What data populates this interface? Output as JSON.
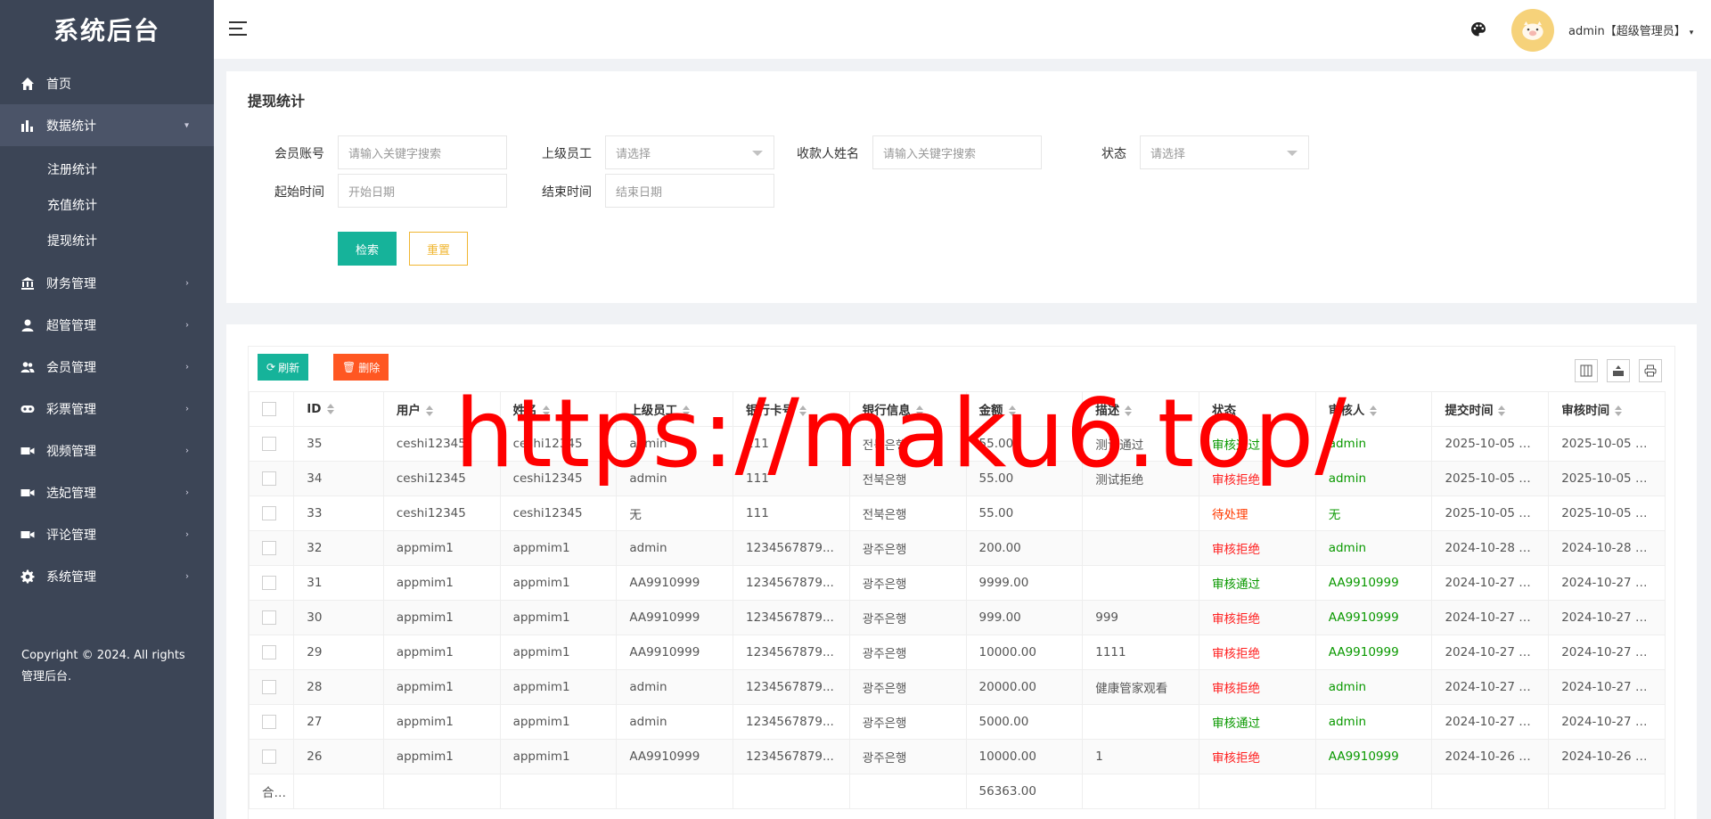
{
  "brand": "系统后台",
  "sidebar": {
    "items": [
      {
        "label": "首页",
        "icon": "home-icon"
      },
      {
        "label": "数据统计",
        "icon": "bar-chart-icon",
        "sub": [
          "注册统计",
          "充值统计",
          "提现统计"
        ]
      },
      {
        "label": "财务管理",
        "icon": "bank-icon"
      },
      {
        "label": "超管管理",
        "icon": "user-icon"
      },
      {
        "label": "会员管理",
        "icon": "users-icon"
      },
      {
        "label": "彩票管理",
        "icon": "gamepad-icon"
      },
      {
        "label": "视频管理",
        "icon": "video-icon"
      },
      {
        "label": "选妃管理",
        "icon": "video-icon"
      },
      {
        "label": "评论管理",
        "icon": "video-icon"
      },
      {
        "label": "系统管理",
        "icon": "gear-icon"
      }
    ],
    "copyright": "Copyright © 2024. All rights 管理后台."
  },
  "header": {
    "user": "admin【超级管理员】"
  },
  "filter": {
    "title": "提现统计",
    "member_label": "会员账号",
    "member_placeholder": "请输入关键字搜索",
    "superior_label": "上级员工",
    "superior_placeholder": "请选择",
    "payee_label": "收款人姓名",
    "payee_placeholder": "请输入关键字搜索",
    "status_label": "状态",
    "status_placeholder": "请选择",
    "start_label": "起始时间",
    "start_placeholder": "开始日期",
    "end_label": "结束时间",
    "end_placeholder": "结束日期",
    "search_button": "检索",
    "reset_button": "重置"
  },
  "toolbar": {
    "refresh": "刷新",
    "delete": "删除"
  },
  "table": {
    "columns": [
      "ID",
      "用户",
      "姓名",
      "上级员工",
      "银行卡号",
      "银行信息",
      "金额",
      "描述",
      "状态",
      "审核人",
      "提交时间",
      "审核时间"
    ],
    "rows": [
      [
        "35",
        "ceshi12345",
        "ceshi12345",
        "admin",
        "111",
        "전북은행",
        "55.00",
        "测试通过",
        "审核通过",
        "admin",
        "2025-10-05 1...",
        "2025-10-05 1..."
      ],
      [
        "34",
        "ceshi12345",
        "ceshi12345",
        "admin",
        "111",
        "전북은행",
        "55.00",
        "测试拒绝",
        "审核拒绝",
        "admin",
        "2025-10-05 1...",
        "2025-10-05 1..."
      ],
      [
        "33",
        "ceshi12345",
        "ceshi12345",
        "无",
        "111",
        "전북은행",
        "55.00",
        "",
        "待处理",
        "无",
        "2025-10-05 1...",
        "2025-10-05 1..."
      ],
      [
        "32",
        "appmim1",
        "appmim1",
        "admin",
        "1234567879...",
        "광주은행",
        "200.00",
        "",
        "审核拒绝",
        "admin",
        "2024-10-28 0...",
        "2024-10-28 0..."
      ],
      [
        "31",
        "appmim1",
        "appmim1",
        "AA9910999",
        "1234567879...",
        "광주은행",
        "9999.00",
        "",
        "审核通过",
        "AA9910999",
        "2024-10-27 1...",
        "2024-10-27 1..."
      ],
      [
        "30",
        "appmim1",
        "appmim1",
        "AA9910999",
        "1234567879...",
        "광주은행",
        "999.00",
        "999",
        "审核拒绝",
        "AA9910999",
        "2024-10-27 1...",
        "2024-10-27 1..."
      ],
      [
        "29",
        "appmim1",
        "appmim1",
        "AA9910999",
        "1234567879...",
        "광주은행",
        "10000.00",
        "1111",
        "审核拒绝",
        "AA9910999",
        "2024-10-27 1...",
        "2024-10-27 1..."
      ],
      [
        "28",
        "appmim1",
        "appmim1",
        "admin",
        "1234567879...",
        "광주은행",
        "20000.00",
        "健康管家观看",
        "审核拒绝",
        "admin",
        "2024-10-27 0...",
        "2024-10-27 0..."
      ],
      [
        "27",
        "appmim1",
        "appmim1",
        "admin",
        "1234567879...",
        "광주은행",
        "5000.00",
        "",
        "审核通过",
        "admin",
        "2024-10-27 0...",
        "2024-10-27 0..."
      ],
      [
        "26",
        "appmim1",
        "appmim1",
        "AA9910999",
        "1234567879...",
        "광주은행",
        "10000.00",
        "1",
        "审核拒绝",
        "AA9910999",
        "2024-10-26 2...",
        "2024-10-26 2..."
      ]
    ],
    "total_label": "合...",
    "total_amount": "56363.00"
  },
  "watermark": "https://maku6.top/",
  "colors": {
    "sidebar": "#3c4556",
    "primary": "#16b39a",
    "danger": "#ff5722",
    "warning": "#f0b631",
    "pass": "#0a9900",
    "reject": "#ff2020"
  }
}
